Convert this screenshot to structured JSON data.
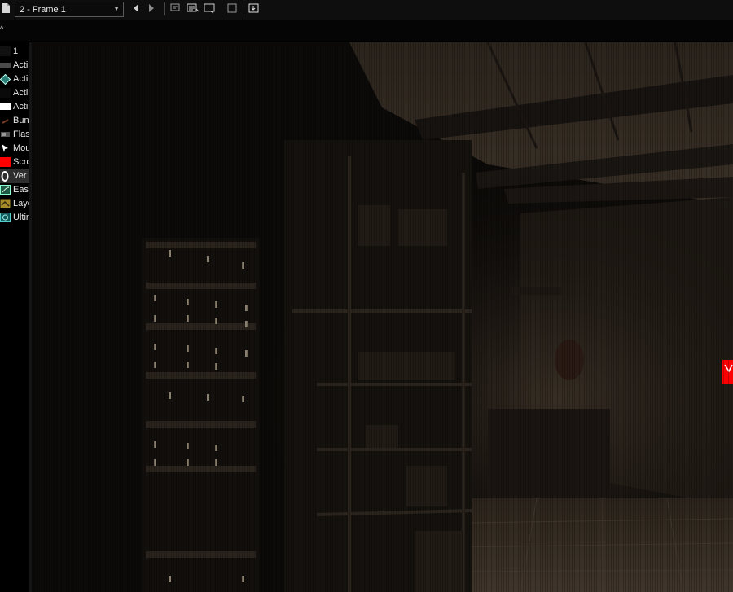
{
  "toolbar": {
    "frame_select_value": "2 - Frame 1",
    "icons": [
      "file-icon",
      "prev-frame-icon",
      "next-frame-icon",
      "frame-list-icon",
      "frame-editor-icon",
      "frame-window-icon",
      "frame-box-icon",
      "export-frame-icon"
    ]
  },
  "subbar": {
    "collapse_glyph": "^"
  },
  "objects": [
    {
      "label": "1",
      "icon": "blank-swatch-icon",
      "color": "#111111"
    },
    {
      "label": "Acti",
      "icon": "active-object-icon",
      "color": "#4a4a4a"
    },
    {
      "label": "Acti",
      "icon": "diamond-active-icon",
      "color": "#3fa59b"
    },
    {
      "label": "Acti",
      "icon": "active-black-icon",
      "color": "#0a0a0a"
    },
    {
      "label": "Acti",
      "icon": "active-white-icon",
      "color": "#ffffff"
    },
    {
      "label": "Bun",
      "icon": "bundle-icon",
      "color": "#5a2a1a"
    },
    {
      "label": "Flas",
      "icon": "flashlight-icon",
      "color": "#7a7a7a"
    },
    {
      "label": "Mou",
      "icon": "mouse-pointer-icon",
      "color": "#ffffff"
    },
    {
      "label": "Scro",
      "icon": "scroll-icon",
      "color": "#ff0000"
    },
    {
      "label": "Ver",
      "icon": "version-icon",
      "color": "#ffffff"
    },
    {
      "label": "Easi",
      "icon": "easing-icon",
      "color": "#2f8f6a"
    },
    {
      "label": "Laye",
      "icon": "layers-icon",
      "color": "#c9a73a"
    },
    {
      "label": "Ultin",
      "icon": "ultimate-icon",
      "color": "#2aa0a0"
    }
  ],
  "selected_index": 9,
  "scene": {
    "description_icon": "scene-preview",
    "marker_color": "#ff0000"
  }
}
